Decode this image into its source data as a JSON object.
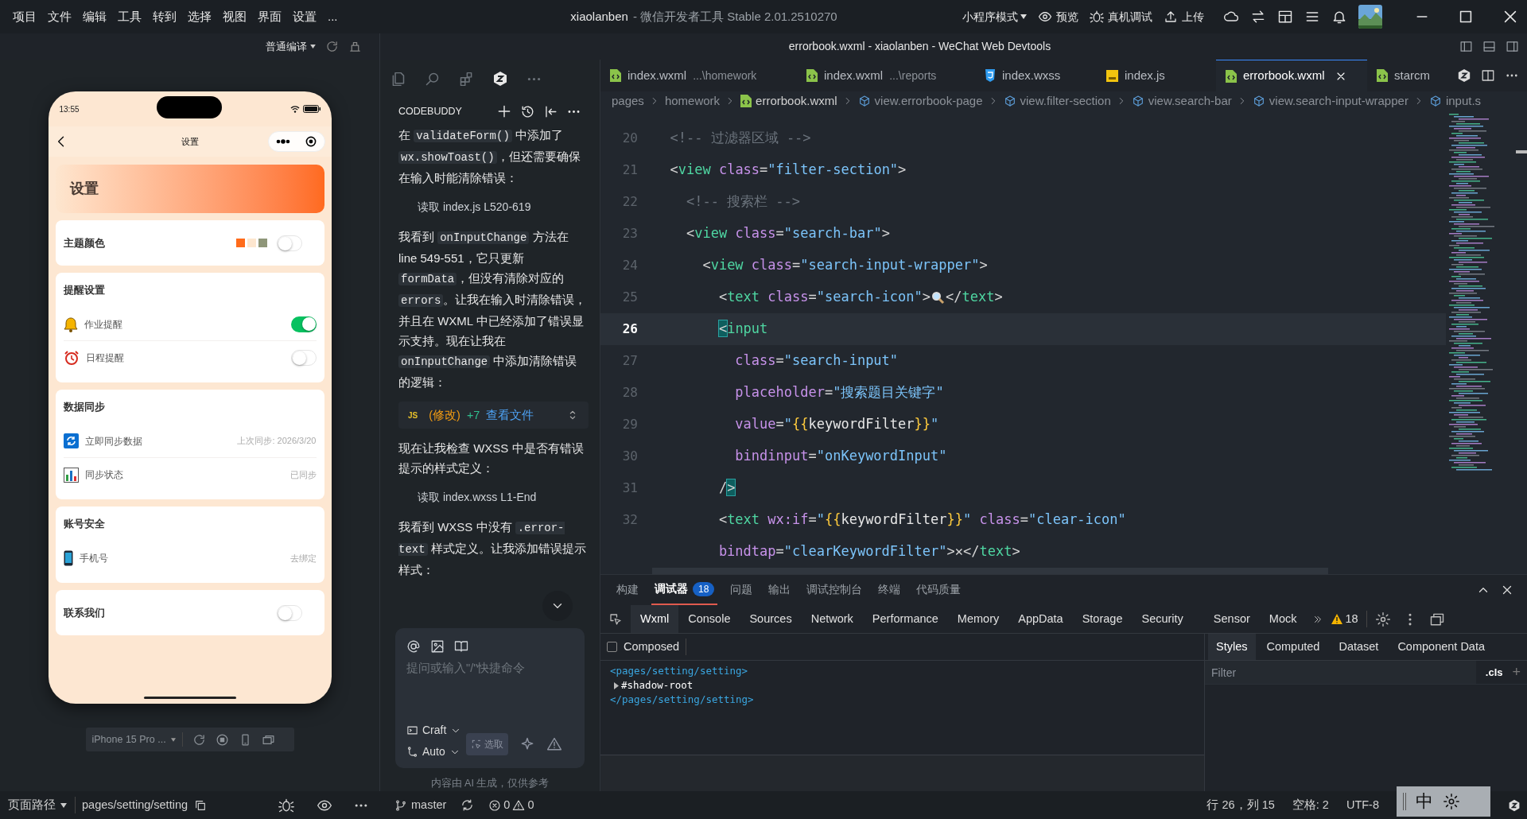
{
  "title_bar": {
    "menu": [
      "项目",
      "文件",
      "编辑",
      "工具",
      "转到",
      "选择",
      "视图",
      "界面",
      "设置",
      "..."
    ],
    "app_name": "xiaolanben",
    "product": "- 微信开发者工具 Stable 2.01.2510270",
    "mode": "小程序模式",
    "actions": [
      "预览",
      "真机调试",
      "上传"
    ]
  },
  "sub_bar": {
    "compile_mode": "普通编译",
    "window_title": "errorbook.wxml - xiaolanben - WeChat Web Devtools"
  },
  "simulator": {
    "time": "13:55",
    "nav_title": "设置",
    "header": "设置",
    "device": "iPhone 15 Pro ...",
    "sections": [
      {
        "title": "主题颜色",
        "swatches": [
          {
            "color": "#ff6b1a"
          },
          {
            "color": "#fde6cf"
          },
          {
            "color": "#8f9679"
          }
        ],
        "on": false
      },
      {
        "title": "提醒设置",
        "rows": [
          {
            "kind": "toggle",
            "label": "作业提醒",
            "on": true
          },
          {
            "kind": "toggle",
            "label": "日程提醒",
            "on": false
          }
        ]
      },
      {
        "title": "数据同步",
        "rows": [
          {
            "kind": "value",
            "label": "立即同步数据",
            "value": "上次同步: 2026/3/20"
          },
          {
            "kind": "value",
            "label": "同步状态",
            "value": "已同步"
          }
        ]
      },
      {
        "title": "账号安全",
        "rows": [
          {
            "kind": "value",
            "label": "手机号",
            "value": "去绑定"
          }
        ]
      },
      {
        "title": "联系我们",
        "on": false
      }
    ]
  },
  "chat": {
    "title": "CODEBUDDY",
    "messages": [
      {
        "kind": "text",
        "segments": [
          {
            "kind": "text",
            "text": "在 "
          },
          {
            "kind": "code",
            "text": "validateForm()"
          },
          {
            "kind": "text",
            "text": " 中添加了 "
          },
          {
            "kind": "code",
            "text": "wx.showToast()"
          },
          {
            "kind": "text",
            "text": "，但还需要确保在输入时能清除错误："
          }
        ]
      },
      {
        "kind": "tool",
        "text": "读取 index.js L520-619"
      },
      {
        "kind": "text",
        "segments": [
          {
            "kind": "text",
            "text": "我看到 "
          },
          {
            "kind": "code",
            "text": "onInputChange"
          },
          {
            "kind": "text",
            "text": " 方法在 line 549-551，它只更新 "
          },
          {
            "kind": "code",
            "text": "formData"
          },
          {
            "kind": "text",
            "text": "，但没有清除对应的 "
          },
          {
            "kind": "code",
            "text": "errors"
          },
          {
            "kind": "text",
            "text": "。让我在输入时清除错误，并且在 WXML 中已经添加了错误显示支持。现在让我在 "
          },
          {
            "kind": "code",
            "text": "onInputChange"
          },
          {
            "kind": "text",
            "text": " 中添加清除错误的逻辑："
          }
        ]
      },
      {
        "kind": "file_change",
        "lang": "JS",
        "status": "(修改)",
        "added": "+7",
        "link": "查看文件"
      },
      {
        "kind": "text",
        "segments": [
          {
            "kind": "text",
            "text": "现在让我检查 WXSS 中是否有错误提示的样式定义："
          }
        ]
      },
      {
        "kind": "tool",
        "text": "读取 index.wxss L1-End"
      },
      {
        "kind": "text",
        "segments": [
          {
            "kind": "text",
            "text": "我看到 WXSS 中没有 "
          },
          {
            "kind": "code",
            "text": ".error-text"
          },
          {
            "kind": "text",
            "text": " 样式定义。让我添加错误提示样式："
          }
        ]
      }
    ],
    "input": {
      "placeholder": "提问或输入\"/\"快捷命令"
    },
    "mode": "Craft",
    "model": "Auto",
    "pick": "选取",
    "disclaimer": "内容由 AI 生成，仅供参考"
  },
  "editor": {
    "tabs": [
      {
        "label": "index.wxml",
        "hint": "...\\homework",
        "kind": "wxml",
        "selected": false
      },
      {
        "label": "index.wxml",
        "hint": "...\\reports",
        "kind": "wxml",
        "selected": false
      },
      {
        "label": "index.wxss",
        "kind": "wxss",
        "selected": false
      },
      {
        "label": "index.js",
        "kind": "js",
        "selected": false
      },
      {
        "label": "errorbook.wxml",
        "kind": "wxml",
        "selected": true
      },
      {
        "label": "starcm",
        "kind": "wxml",
        "selected": false
      }
    ],
    "breadcrumb": [
      "pages",
      "homework",
      "errorbook.wxml",
      "view.errorbook-page",
      "view.filter-section",
      "view.search-bar",
      "view.search-input-wrapper",
      "input.s"
    ],
    "lines": [
      {
        "number": "20",
        "current": false,
        "tokens": [
          {
            "kind": "comment",
            "text": "  <!-- 过滤器区域 -->"
          }
        ]
      },
      {
        "number": "21",
        "current": false,
        "tokens": [
          {
            "kind": "punct",
            "text": "  <"
          },
          {
            "kind": "tag",
            "text": "view"
          },
          {
            "kind": "attr",
            "text": " class"
          },
          {
            "kind": "punct",
            "text": "="
          },
          {
            "kind": "string",
            "text": "\"filter-section\""
          },
          {
            "kind": "punct",
            "text": ">"
          }
        ]
      },
      {
        "number": "22",
        "current": false,
        "tokens": [
          {
            "kind": "comment",
            "text": "    <!-- 搜索栏 -->"
          }
        ]
      },
      {
        "number": "23",
        "current": false,
        "tokens": [
          {
            "kind": "punct",
            "text": "    <"
          },
          {
            "kind": "tag",
            "text": "view"
          },
          {
            "kind": "attr",
            "text": " class"
          },
          {
            "kind": "punct",
            "text": "="
          },
          {
            "kind": "string",
            "text": "\"search-bar\""
          },
          {
            "kind": "punct",
            "text": ">"
          }
        ]
      },
      {
        "number": "24",
        "current": false,
        "tokens": [
          {
            "kind": "punct",
            "text": "      <"
          },
          {
            "kind": "tag",
            "text": "view"
          },
          {
            "kind": "attr",
            "text": " class"
          },
          {
            "kind": "punct",
            "text": "="
          },
          {
            "kind": "string",
            "text": "\"search-input-wrapper\""
          },
          {
            "kind": "punct",
            "text": ">"
          }
        ]
      },
      {
        "number": "25",
        "current": false,
        "tokens": [
          {
            "kind": "punct",
            "text": "        <"
          },
          {
            "kind": "tag",
            "text": "text"
          },
          {
            "kind": "attr",
            "text": " class"
          },
          {
            "kind": "punct",
            "text": "="
          },
          {
            "kind": "string",
            "text": "\"search-icon\""
          },
          {
            "kind": "punct",
            "text": ">"
          },
          {
            "kind": "magnifier"
          },
          {
            "kind": "punct",
            "text": "</"
          },
          {
            "kind": "tag",
            "text": "text"
          },
          {
            "kind": "punct",
            "text": ">"
          }
        ]
      },
      {
        "number": "26",
        "current": true,
        "tokens": [
          {
            "kind": "match",
            "text": "        <"
          },
          {
            "kind": "tag",
            "text": "input"
          }
        ]
      },
      {
        "number": "27",
        "current": false,
        "tokens": [
          {
            "kind": "attr",
            "text": "          class"
          },
          {
            "kind": "punct",
            "text": "="
          },
          {
            "kind": "string",
            "text": "\"search-input\""
          }
        ]
      },
      {
        "number": "28",
        "current": false,
        "tokens": [
          {
            "kind": "attr",
            "text": "          placeholder"
          },
          {
            "kind": "punct",
            "text": "="
          },
          {
            "kind": "string",
            "text": "\"搜索题目关键字\""
          }
        ]
      },
      {
        "number": "29",
        "current": false,
        "tokens": [
          {
            "kind": "attr",
            "text": "          value"
          },
          {
            "kind": "punct",
            "text": "="
          },
          {
            "kind": "string",
            "text": "\""
          },
          {
            "kind": "brace",
            "text": "{{"
          },
          {
            "kind": "plain",
            "text": "keywordFilter"
          },
          {
            "kind": "brace",
            "text": "}}"
          },
          {
            "kind": "string",
            "text": "\""
          }
        ]
      },
      {
        "number": "30",
        "current": false,
        "tokens": [
          {
            "kind": "attr",
            "text": "          bindinput"
          },
          {
            "kind": "punct",
            "text": "="
          },
          {
            "kind": "string",
            "text": "\"onKeywordInput\""
          }
        ]
      },
      {
        "number": "31",
        "current": false,
        "tokens": [
          {
            "kind": "punct",
            "text": "        /"
          },
          {
            "kind": "match",
            "text": ">"
          }
        ]
      },
      {
        "number": "32",
        "current": false,
        "tokens": [
          {
            "kind": "punct",
            "text": "        <"
          },
          {
            "kind": "tag",
            "text": "text"
          },
          {
            "kind": "attr",
            "text": " wx:if"
          },
          {
            "kind": "punct",
            "text": "="
          },
          {
            "kind": "string",
            "text": "\""
          },
          {
            "kind": "brace",
            "text": "{{"
          },
          {
            "kind": "plain",
            "text": "keywordFilter"
          },
          {
            "kind": "brace",
            "text": "}}"
          },
          {
            "kind": "string",
            "text": "\""
          },
          {
            "kind": "attr",
            "text": " class"
          },
          {
            "kind": "punct",
            "text": "="
          },
          {
            "kind": "string",
            "text": "\"clear-icon\""
          }
        ]
      },
      {
        "tokens": [
          {
            "kind": "attr",
            "text": "        bindtap"
          },
          {
            "kind": "punct",
            "text": "="
          },
          {
            "kind": "string",
            "text": "\"clearKeywordFilter\""
          },
          {
            "kind": "punct",
            "text": ">✕</"
          },
          {
            "kind": "tag",
            "text": "text"
          },
          {
            "kind": "punct",
            "text": ">"
          }
        ]
      }
    ]
  },
  "devtools": {
    "panels": [
      {
        "label": "构建",
        "selected": false
      },
      {
        "label": "调试器",
        "selected": true,
        "badge": "18"
      },
      {
        "label": "问题",
        "selected": false
      },
      {
        "label": "输出",
        "selected": false
      },
      {
        "label": "调试控制台",
        "selected": false
      },
      {
        "label": "终端",
        "selected": false
      },
      {
        "label": "代码质量",
        "selected": false
      }
    ],
    "tabs": [
      {
        "label": "Wxml",
        "selected": true
      },
      {
        "label": "Console",
        "selected": false
      },
      {
        "label": "Sources",
        "selected": false
      },
      {
        "label": "Network",
        "selected": false
      },
      {
        "label": "Performance",
        "selected": false
      },
      {
        "label": "Memory",
        "selected": false
      },
      {
        "label": "AppData",
        "selected": false
      },
      {
        "label": "Storage",
        "selected": false
      },
      {
        "label": "Security",
        "selected": false
      },
      {
        "label": "Sensor",
        "selected": false
      },
      {
        "label": "Mock",
        "selected": false
      }
    ],
    "warnings": "18",
    "composed_label": "Composed",
    "composed": false,
    "tree": [
      {
        "kind": "open",
        "text": "<pages/setting/setting>"
      },
      {
        "kind": "node",
        "text": "#shadow-root"
      },
      {
        "kind": "close",
        "text": "</pages/setting/setting>"
      }
    ],
    "style_tabs": [
      {
        "label": "Styles",
        "selected": true
      },
      {
        "label": "Computed",
        "selected": false
      },
      {
        "label": "Dataset",
        "selected": false
      },
      {
        "label": "Component Data",
        "selected": false
      }
    ],
    "filter_placeholder": "Filter",
    "cls": ".cls",
    "add": "+"
  },
  "status_bar": {
    "path_label": "页面路径",
    "path": "pages/setting/setting",
    "branch": "master",
    "errors": "0",
    "warnings": "0",
    "position": "行 26，列 15",
    "spaces": "空格: 2",
    "encoding": "UTF-8",
    "ime": "中"
  }
}
